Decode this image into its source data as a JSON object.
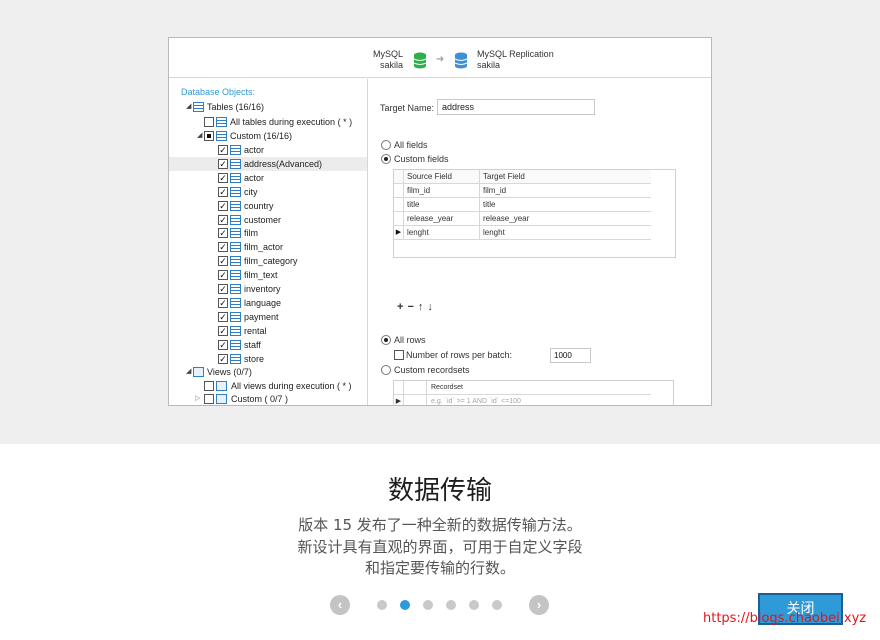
{
  "header": {
    "source": {
      "line1": "MySQL",
      "line2": "sakila"
    },
    "target": {
      "line1": "MySQL Replication",
      "line2": "sakila"
    }
  },
  "tree": {
    "title": "Database Objects:",
    "tables_label": "Tables (16/16)",
    "all_tables_label": "All tables during execution ( * )",
    "custom_label": "Custom (16/16)",
    "tables": [
      "actor",
      "address(Advanced)",
      "actor",
      "city",
      "country",
      "customer",
      "film",
      "film_actor",
      "film_category",
      "film_text",
      "inventory",
      "language",
      "payment",
      "rental",
      "staff",
      "store"
    ],
    "views_label": "Views (0/7)",
    "all_views_label": "All views during execution ( * )",
    "custom_views_label": "Custom ( 0/7 )"
  },
  "target": {
    "label": "Target Name:",
    "value": "address"
  },
  "fields": {
    "all_fields_label": "All fields",
    "custom_fields_label": "Custom fields",
    "columns": [
      "Source Field",
      "Target Field"
    ],
    "rows": [
      [
        "film_id",
        "film_id"
      ],
      [
        "title",
        "title"
      ],
      [
        "release_year",
        "release_year"
      ],
      [
        "lenght",
        "lenght"
      ]
    ]
  },
  "rows_opts": {
    "all_rows_label": "All rows",
    "batch_label": "Number of rows per batch:",
    "batch_value": "1000",
    "custom_recordsets_label": "Custom recordsets",
    "recordset_header": "Recordset",
    "recordset_placeholder": "e.g. `id` >= 1 AND `id` <=100"
  },
  "feature": {
    "title": "数据传输",
    "desc_lines": [
      "版本 15 发布了一种全新的数据传输方法。",
      "新设计具有直观的界面，可用于自定义字段",
      "和指定要传输的行数。"
    ]
  },
  "pager": {
    "total": 6,
    "active": 2
  },
  "close_label": "关闭",
  "watermark": "https://blogs.chaobei.xyz",
  "colors": {
    "accent": "#2f9ad8",
    "source_db": "#2bb04a",
    "target_db": "#3d8fd6",
    "watermark": "#e0151b"
  }
}
